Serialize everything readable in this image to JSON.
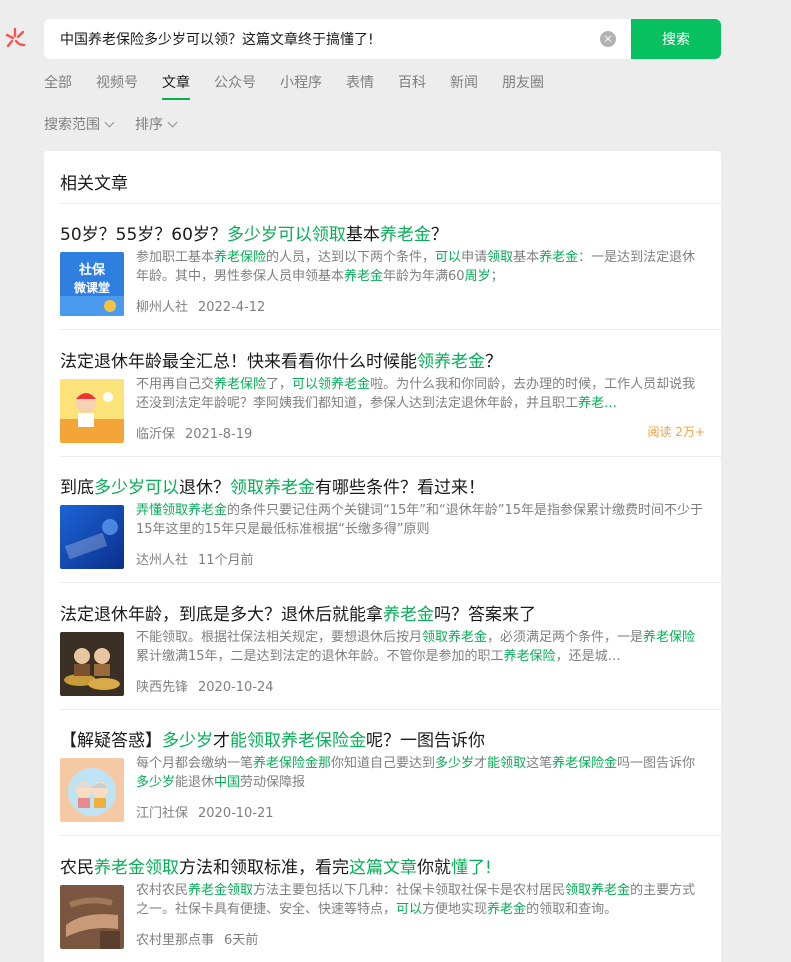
{
  "search": {
    "query": "中国养老保险多少岁可以领？这篇文章终于搞懂了!",
    "clear_glyph": "×",
    "button_label": "搜索"
  },
  "tabs": [
    {
      "label": "全部",
      "active": false
    },
    {
      "label": "视频号",
      "active": false
    },
    {
      "label": "文章",
      "active": true
    },
    {
      "label": "公众号",
      "active": false
    },
    {
      "label": "小程序",
      "active": false
    },
    {
      "label": "表情",
      "active": false
    },
    {
      "label": "百科",
      "active": false
    },
    {
      "label": "新闻",
      "active": false
    },
    {
      "label": "朋友圈",
      "active": false
    }
  ],
  "filters": {
    "scope_label": "搜索范围",
    "sort_label": "排序"
  },
  "panel": {
    "title": "相关文章"
  },
  "colors": {
    "accent": "#07c160",
    "highlight": "#06ae56",
    "reads": "#fa9d3b"
  },
  "articles": [
    {
      "title": [
        [
          "50岁？55岁？60岁？",
          false
        ],
        [
          "多少岁可以领取",
          true
        ],
        [
          "基本",
          false
        ],
        [
          "养老金",
          true
        ],
        [
          "？",
          false
        ]
      ],
      "snippet": [
        [
          "参加职工基本",
          false
        ],
        [
          "养老保险",
          true
        ],
        [
          "的人员，达到以下两个条件，",
          false
        ],
        [
          "可以",
          true
        ],
        [
          "申请",
          false
        ],
        [
          "领取",
          true
        ],
        [
          "基本",
          false
        ],
        [
          "养老金",
          true
        ],
        [
          "：一是达到法定退休年龄。其中，男性参保人员申领基本",
          false
        ],
        [
          "养老金",
          true
        ],
        [
          "年龄为年满60",
          false
        ],
        [
          "周岁",
          true
        ],
        [
          "；",
          false
        ]
      ],
      "source": "柳州人社",
      "date": "2022-4-12",
      "reads": "",
      "thumb": "thumb-1"
    },
    {
      "title": [
        [
          "法定退休年龄最全汇总！快来看看你什么时候能",
          false
        ],
        [
          "领养老金",
          true
        ],
        [
          "？",
          false
        ]
      ],
      "snippet": [
        [
          "不用再自己交",
          false
        ],
        [
          "养老保险",
          true
        ],
        [
          "了，",
          false
        ],
        [
          "可以领养老金",
          true
        ],
        [
          "啦。为什么我和你同龄，去办理的时候，工作人员却说我还没到法定年龄呢？李阿姨我们都知道，参保人达到法定退休年龄，并且职工",
          false
        ],
        [
          "养老…",
          true
        ]
      ],
      "source": "临沂保",
      "date": "2021-8-19",
      "reads": "阅读 2万+",
      "thumb": "thumb-2"
    },
    {
      "title": [
        [
          "到底",
          false
        ],
        [
          "多少岁可以",
          true
        ],
        [
          "退休？",
          false
        ],
        [
          "领取养老金",
          true
        ],
        [
          "有哪些条件？看过来！",
          false
        ]
      ],
      "snippet": [
        [
          "弄懂领取养老金",
          true
        ],
        [
          "的条件只要记住两个关键词“15年”和“退休年龄”15年是指参保累计缴费时间不少于15年这里的15年只是最低标准根据“长缴多得”原则",
          false
        ]
      ],
      "source": "达州人社",
      "date": "11个月前",
      "reads": "",
      "thumb": "thumb-3"
    },
    {
      "title": [
        [
          "法定退休年龄，到底是多大？退休后就能拿",
          false
        ],
        [
          "养老金",
          true
        ],
        [
          "吗？答案来了",
          false
        ]
      ],
      "snippet": [
        [
          "不能领取。根据社保法相关规定，要想退休后按月",
          false
        ],
        [
          "领取养老金",
          true
        ],
        [
          "，必须满足两个条件，一是",
          false
        ],
        [
          "养老保险",
          true
        ],
        [
          "累计缴满15年，二是达到法定的退休年龄。不管你是参加的职工",
          false
        ],
        [
          "养老保险",
          true
        ],
        [
          "，还是城…",
          false
        ]
      ],
      "source": "陕西先锋",
      "date": "2020-10-24",
      "reads": "",
      "thumb": "thumb-4"
    },
    {
      "title": [
        [
          "【解疑答惑】",
          false
        ],
        [
          "多少岁",
          true
        ],
        [
          "才",
          false
        ],
        [
          "能领取养老保险金",
          true
        ],
        [
          "呢？一图告诉你",
          false
        ]
      ],
      "snippet": [
        [
          "每个月都会缴纳一笔",
          false
        ],
        [
          "养老保险金那",
          true
        ],
        [
          "你知道自己要达到",
          false
        ],
        [
          "多少岁",
          true
        ],
        [
          "才",
          false
        ],
        [
          "能领取",
          true
        ],
        [
          "这笔",
          false
        ],
        [
          "养老保险金",
          true
        ],
        [
          "吗一图告诉你",
          false
        ],
        [
          "多少岁",
          true
        ],
        [
          "能退休",
          false
        ],
        [
          "中国",
          true
        ],
        [
          "劳动保障报",
          false
        ]
      ],
      "source": "江门社保",
      "date": "2020-10-21",
      "reads": "",
      "thumb": "thumb-5"
    },
    {
      "title": [
        [
          "农民",
          false
        ],
        [
          "养老金领取",
          true
        ],
        [
          "方法和领取标准，看完",
          false
        ],
        [
          "这篇文章",
          true
        ],
        [
          "你就",
          false
        ],
        [
          "懂了!",
          true
        ]
      ],
      "snippet": [
        [
          "农村农民",
          false
        ],
        [
          "养老金领取",
          true
        ],
        [
          "方法主要包括以下几种：社保卡领取社保卡是农村居民",
          false
        ],
        [
          "领取养老金",
          true
        ],
        [
          "的主要方式之一。社保卡具有便捷、安全、快速等特点，",
          false
        ],
        [
          "可以",
          true
        ],
        [
          "方便地实现",
          false
        ],
        [
          "养老金",
          true
        ],
        [
          "的领取和查询。",
          false
        ]
      ],
      "source": "农村里那点事",
      "date": "6天前",
      "reads": "",
      "thumb": "thumb-6"
    }
  ]
}
